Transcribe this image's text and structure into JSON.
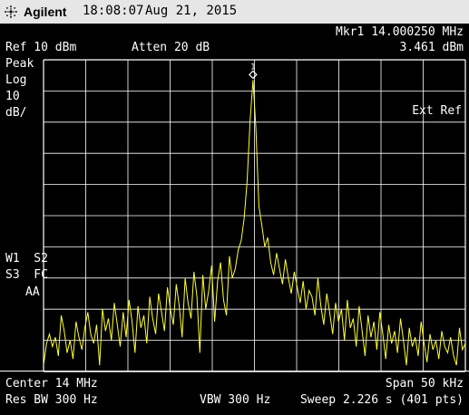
{
  "header": {
    "brand": "Agilent",
    "time": "18:08:07",
    "date": "Aug 21, 2015",
    "logo_icon": "agilent-spark-icon"
  },
  "marker": {
    "label": "Mkr1",
    "frequency": "14.000250 MHz",
    "amplitude": "3.461 dBm",
    "number": "1"
  },
  "settings": {
    "ref_level": "Ref 10 dBm",
    "attenuation": "Atten 20 dB",
    "detector": "Peak",
    "scale_type": "Log",
    "scale_value": "10",
    "scale_unit": "dB/",
    "ext_ref": "Ext Ref",
    "trace_row1": "W1  S2",
    "trace_row2": "S3  FC",
    "trace_row3": "AA"
  },
  "footer": {
    "center": "Center 14 MHz",
    "span": "Span 50 kHz",
    "res_bw": "Res BW 300 Hz",
    "vbw": "VBW 300 Hz",
    "sweep": "Sweep 2.226 s (401 pts)"
  },
  "colors": {
    "trace": "#ffff33",
    "grid": "#ffffff",
    "background": "#000000",
    "text": "#ffffff"
  },
  "chart_data": {
    "type": "line",
    "x_unit": "kHz offset from center",
    "xlim": [
      -25,
      25
    ],
    "ylim": [
      -90,
      10
    ],
    "y_unit": "dBm",
    "grid": true,
    "series": [
      {
        "values": [
          -88,
          -81,
          -78,
          -82,
          -79,
          -85,
          -72,
          -77,
          -84,
          -80,
          -86,
          -74,
          -79,
          -83,
          -76,
          -71,
          -78,
          -81,
          -75,
          -88,
          -70,
          -77,
          -73,
          -80,
          -68,
          -75,
          -82,
          -71,
          -79,
          -67,
          -74,
          -84,
          -69,
          -76,
          -72,
          -81,
          -66,
          -73,
          -78,
          -65,
          -71,
          -77,
          -63,
          -70,
          -75,
          -62,
          -69,
          -79,
          -60,
          -68,
          -73,
          -58,
          -66,
          -84,
          -59,
          -70,
          -64,
          -56,
          -74,
          -61,
          -55,
          -67,
          -72,
          -53,
          -60,
          -57,
          -51,
          -48,
          -41,
          -29,
          -10,
          3.5,
          -12,
          -37,
          -43,
          -50,
          -47,
          -55,
          -59,
          -52,
          -57,
          -62,
          -54,
          -60,
          -65,
          -58,
          -63,
          -68,
          -61,
          -70,
          -64,
          -66,
          -72,
          -60,
          -69,
          -75,
          -65,
          -71,
          -78,
          -68,
          -74,
          -70,
          -80,
          -67,
          -76,
          -73,
          -82,
          -69,
          -77,
          -85,
          -72,
          -79,
          -74,
          -83,
          -71,
          -78,
          -86,
          -75,
          -81,
          -77,
          -84,
          -73,
          -80,
          -88,
          -76,
          -82,
          -79,
          -85,
          -74,
          -81,
          -87,
          -78,
          -83,
          -80,
          -86,
          -77,
          -82,
          -84,
          -79,
          -85,
          -88,
          -76,
          -83,
          -81
        ]
      }
    ]
  }
}
